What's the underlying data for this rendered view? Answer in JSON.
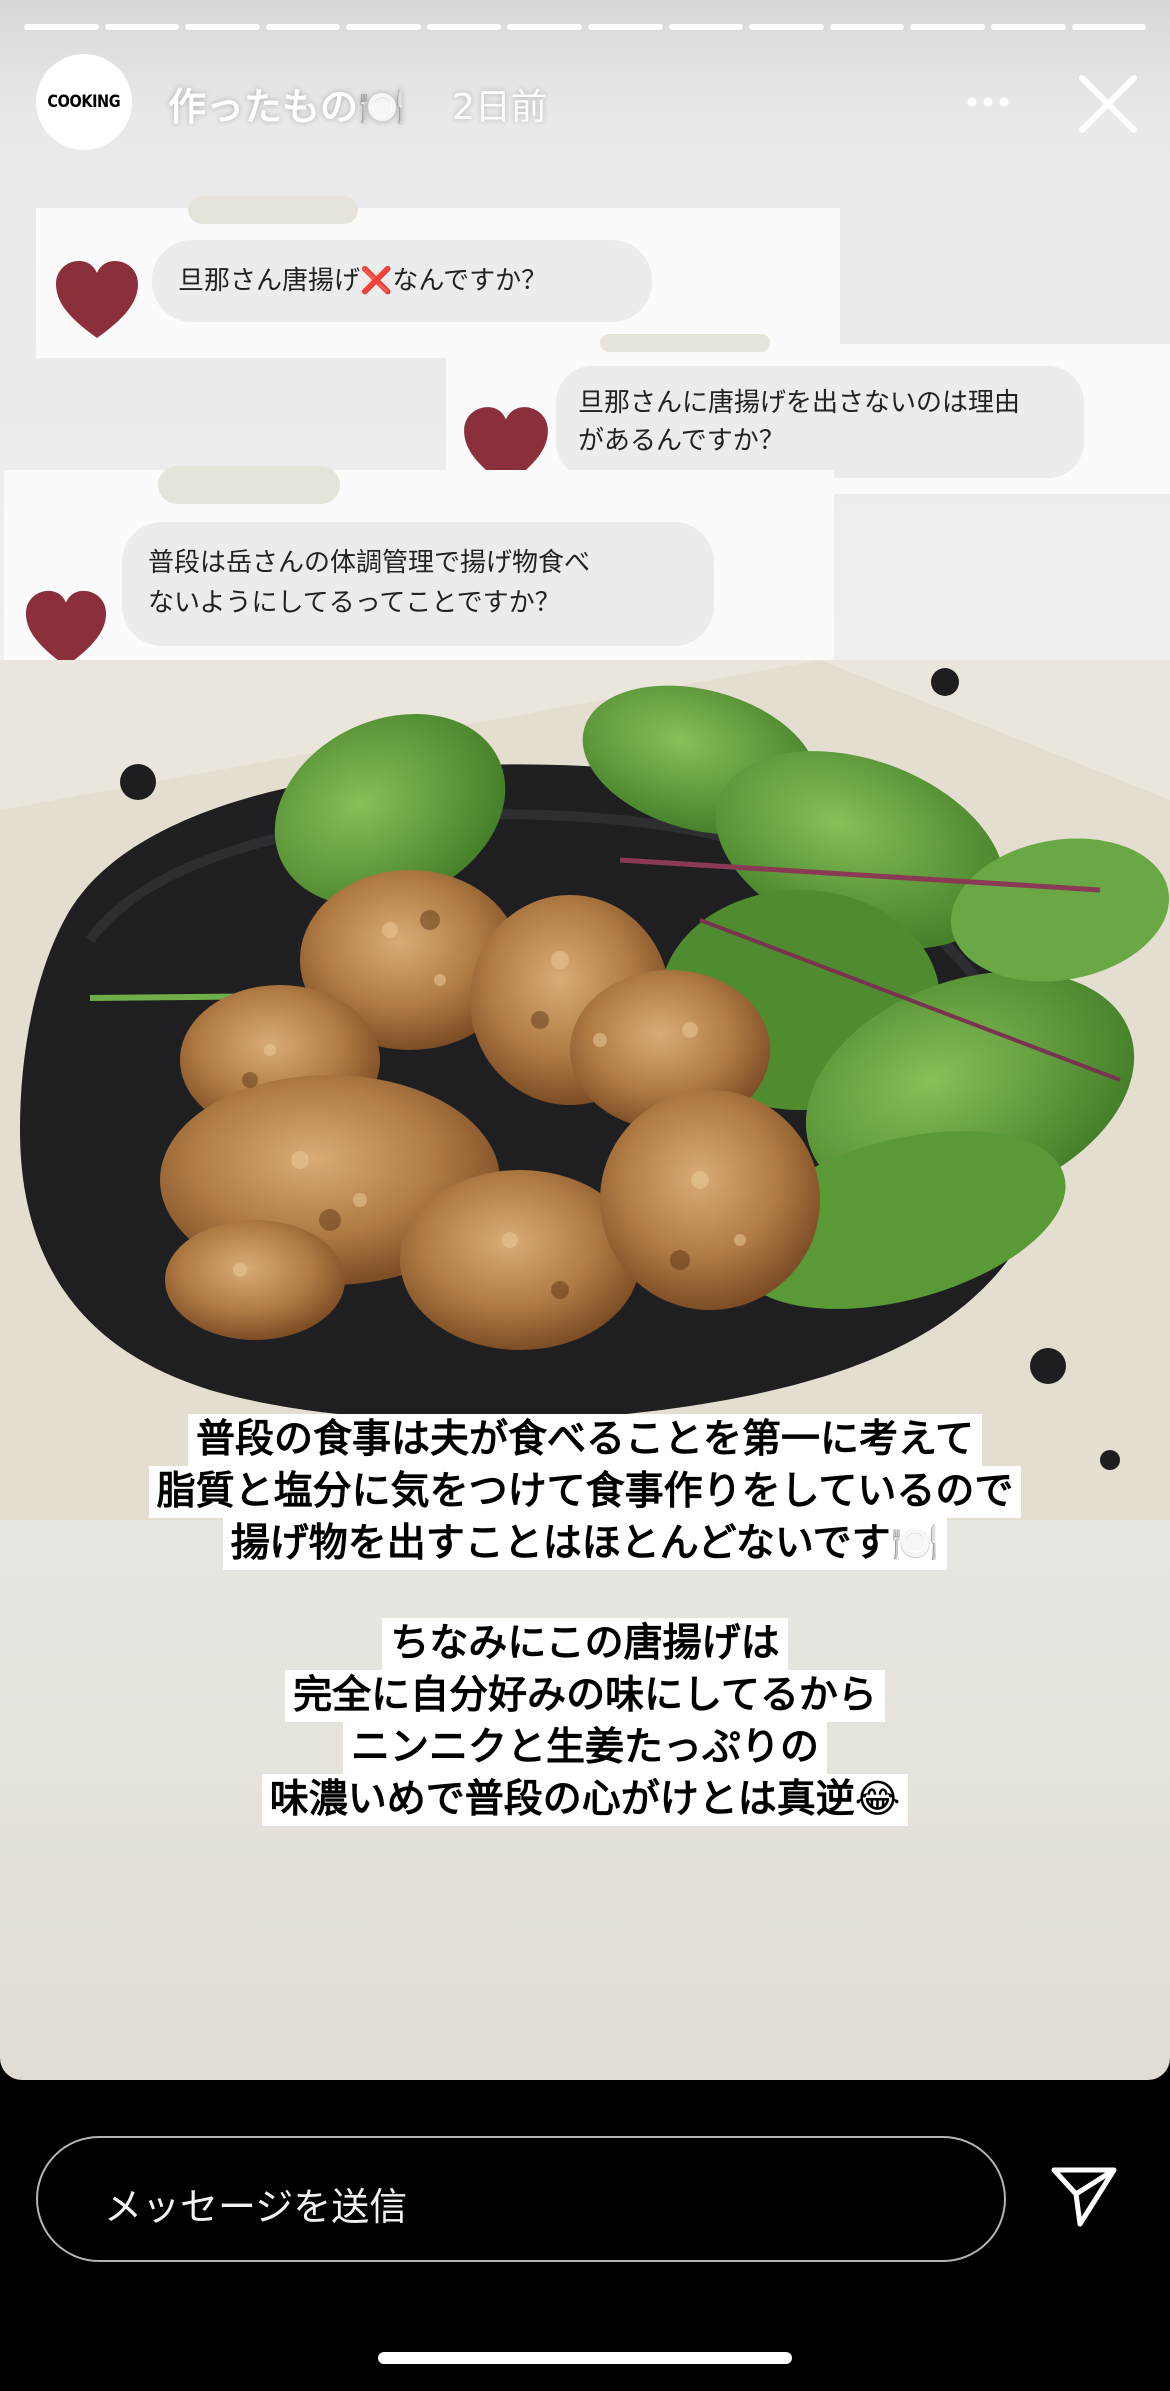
{
  "story": {
    "account_name": "作ったもの🍽️",
    "posted_ago": "2日前",
    "avatar_text": "COOKING",
    "segments_total": 14,
    "segments_viewed": 14
  },
  "questions": [
    "旦那さん唐揚げ❌なんですか？",
    "旦那さんに唐揚げを出さないのは理由",
    "があるんですか？",
    "普段は岳さんの体調管理で揚げ物食べ",
    "ないようにしてるってことですか？"
  ],
  "caption": {
    "lines": [
      "普段の食事は夫が食べることを第一に考えて",
      "脂質と塩分に気をつけて食事作りをしているので",
      "揚げ物を出すことはほとんどないです🍽️",
      "ちなみにこの唐揚げは",
      "完全に自分好みの味にしてるから",
      "ニンニクと生姜たっぷりの",
      "味濃いめで普段の心がけとは真逆😂"
    ]
  },
  "reply": {
    "placeholder": "メッセージを送信"
  },
  "colors": {
    "heart": "#8c2f3d",
    "plate_dark": "#1f1f22",
    "plate_light": "#e9e3d6",
    "karaage": "#b9854e",
    "greens": "#5e9a3a"
  }
}
